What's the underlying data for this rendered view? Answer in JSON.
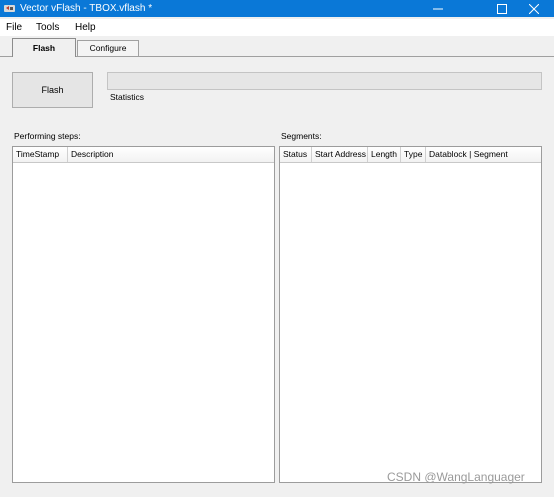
{
  "window": {
    "title": "Vector vFlash - TBOX.vflash *",
    "icon": "vflash-app-icon",
    "accent": "#0a78d7"
  },
  "menu": [
    "File",
    "Tools",
    "Help"
  ],
  "tabs": [
    {
      "label": "Flash",
      "active": true
    },
    {
      "label": "Configure",
      "active": false
    }
  ],
  "flash": {
    "button_label": "Flash",
    "progress": 0,
    "statistics_label": "Statistics"
  },
  "steps_panel": {
    "label": "Performing steps:",
    "columns": [
      "TimeStamp",
      "Description"
    ]
  },
  "segments_panel": {
    "label": "Segments:",
    "columns": [
      "Status",
      "Start Address",
      "Length",
      "Type",
      "Datablock | Segment"
    ]
  },
  "watermark": "CSDN @WangLanguager"
}
